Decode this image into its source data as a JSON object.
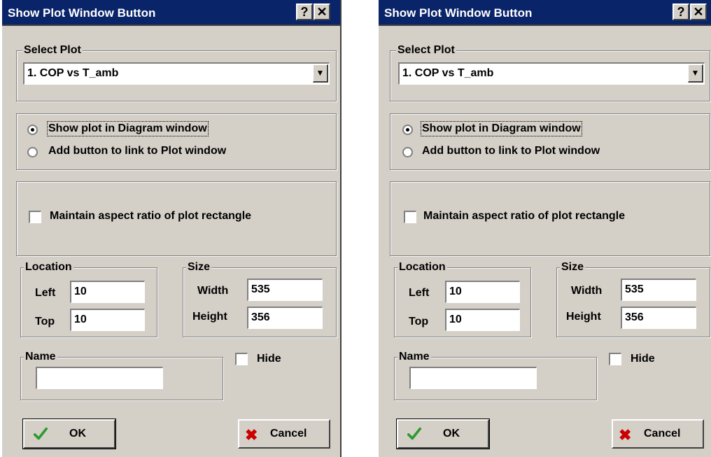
{
  "dialogs": [
    {
      "title": "Show Plot Window Button",
      "help_label": "?",
      "close_label": "✕",
      "select_plot": {
        "legend": "Select Plot",
        "value": "1. COP vs T_amb"
      },
      "radio_options": [
        {
          "label": "Show plot in Diagram window",
          "checked": true
        },
        {
          "label": "Add button to link to Plot window",
          "checked": false
        }
      ],
      "maintain_aspect_label": "Maintain aspect ratio of plot rectangle",
      "location": {
        "legend": "Location",
        "left_label": "Left",
        "left_value": "10",
        "top_label": "Top",
        "top_value": "10"
      },
      "size": {
        "legend": "Size",
        "width_label": "Width",
        "width_value": "535",
        "height_label": "Height",
        "height_value": "356"
      },
      "name": {
        "legend": "Name",
        "value": ""
      },
      "hide_label": "Hide",
      "ok_label": "OK",
      "cancel_label": "Cancel"
    },
    {
      "title": "Show Plot Window Button",
      "help_label": "?",
      "close_label": "✕",
      "select_plot": {
        "legend": "Select Plot",
        "value": "1. COP vs T_amb"
      },
      "radio_options": [
        {
          "label": "Show plot in Diagram window",
          "checked": true
        },
        {
          "label": "Add button to link to Plot window",
          "checked": false
        }
      ],
      "maintain_aspect_label": "Maintain aspect ratio of plot rectangle",
      "location": {
        "legend": "Location",
        "left_label": "Left",
        "left_value": "10",
        "top_label": "Top",
        "top_value": "10"
      },
      "size": {
        "legend": "Size",
        "width_label": "Width",
        "width_value": "535",
        "height_label": "Height",
        "height_value": "356"
      },
      "name": {
        "legend": "Name",
        "value": ""
      },
      "hide_label": "Hide",
      "ok_label": "OK",
      "cancel_label": "Cancel"
    }
  ],
  "colors": {
    "titlebar": "#0a246a",
    "dialog_face": "#d4d0c8",
    "ok_check": "#2e9a2e",
    "cancel_x": "#cc0000"
  },
  "icons": {
    "ok": "check-icon",
    "cancel": "x-icon",
    "combo": "chevron-down-icon"
  }
}
